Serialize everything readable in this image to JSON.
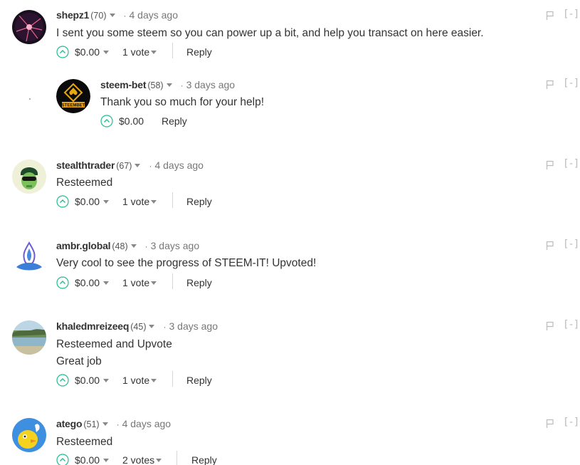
{
  "comments": [
    {
      "author": "shepz1",
      "rep": "(70)",
      "sep": "·",
      "time": "4 days ago",
      "body": [
        "I sent you some steem so you can power up a bit, and help you transact on here easier."
      ],
      "payout": "$0.00",
      "votes": "1 vote",
      "reply": "Reply",
      "collapse": "[-]",
      "avatar": "plasma-ball-avatar"
    },
    {
      "author": "steem-bet",
      "rep": "(58)",
      "sep": "·",
      "time": "3 days ago",
      "body": [
        "Thank you so much for your help!"
      ],
      "payout": "$0.00",
      "votes": "",
      "reply": "Reply",
      "collapse": "[-]",
      "avatar": "steembet-logo-avatar",
      "avatar_text": "STEEMBET"
    },
    {
      "author": "stealthtrader",
      "rep": "(67)",
      "sep": "·",
      "time": "4 days ago",
      "body": [
        "Resteemed"
      ],
      "payout": "$0.00",
      "votes": "1 vote",
      "reply": "Reply",
      "collapse": "[-]",
      "avatar": "masked-face-avatar"
    },
    {
      "author": "ambr.global",
      "rep": "(48)",
      "sep": "·",
      "time": "3 days ago",
      "body": [
        "Very cool to see the progress of STEEM-IT! Upvoted!"
      ],
      "payout": "$0.00",
      "votes": "1 vote",
      "reply": "Reply",
      "collapse": "[-]",
      "avatar": "blue-flame-logo-avatar"
    },
    {
      "author": "khaledmreizeeq",
      "rep": "(45)",
      "sep": "·",
      "time": "3 days ago",
      "body": [
        "Resteemed and Upvote",
        "Great job"
      ],
      "payout": "$0.00",
      "votes": "1 vote",
      "reply": "Reply",
      "collapse": "[-]",
      "avatar": "lake-landscape-avatar"
    },
    {
      "author": "atego",
      "rep": "(51)",
      "sep": "·",
      "time": "4 days ago",
      "body": [
        "Resteemed"
      ],
      "payout": "$0.00",
      "votes": "2 votes",
      "reply": "Reply",
      "collapse": "[-]",
      "avatar": "cartoon-bird-avatar"
    }
  ],
  "colors": {
    "upvote": "#1fbf8f",
    "muted": "#777777",
    "text": "#333333"
  },
  "icons": [
    "upvote-icon",
    "flag-icon",
    "caret-down-icon"
  ]
}
